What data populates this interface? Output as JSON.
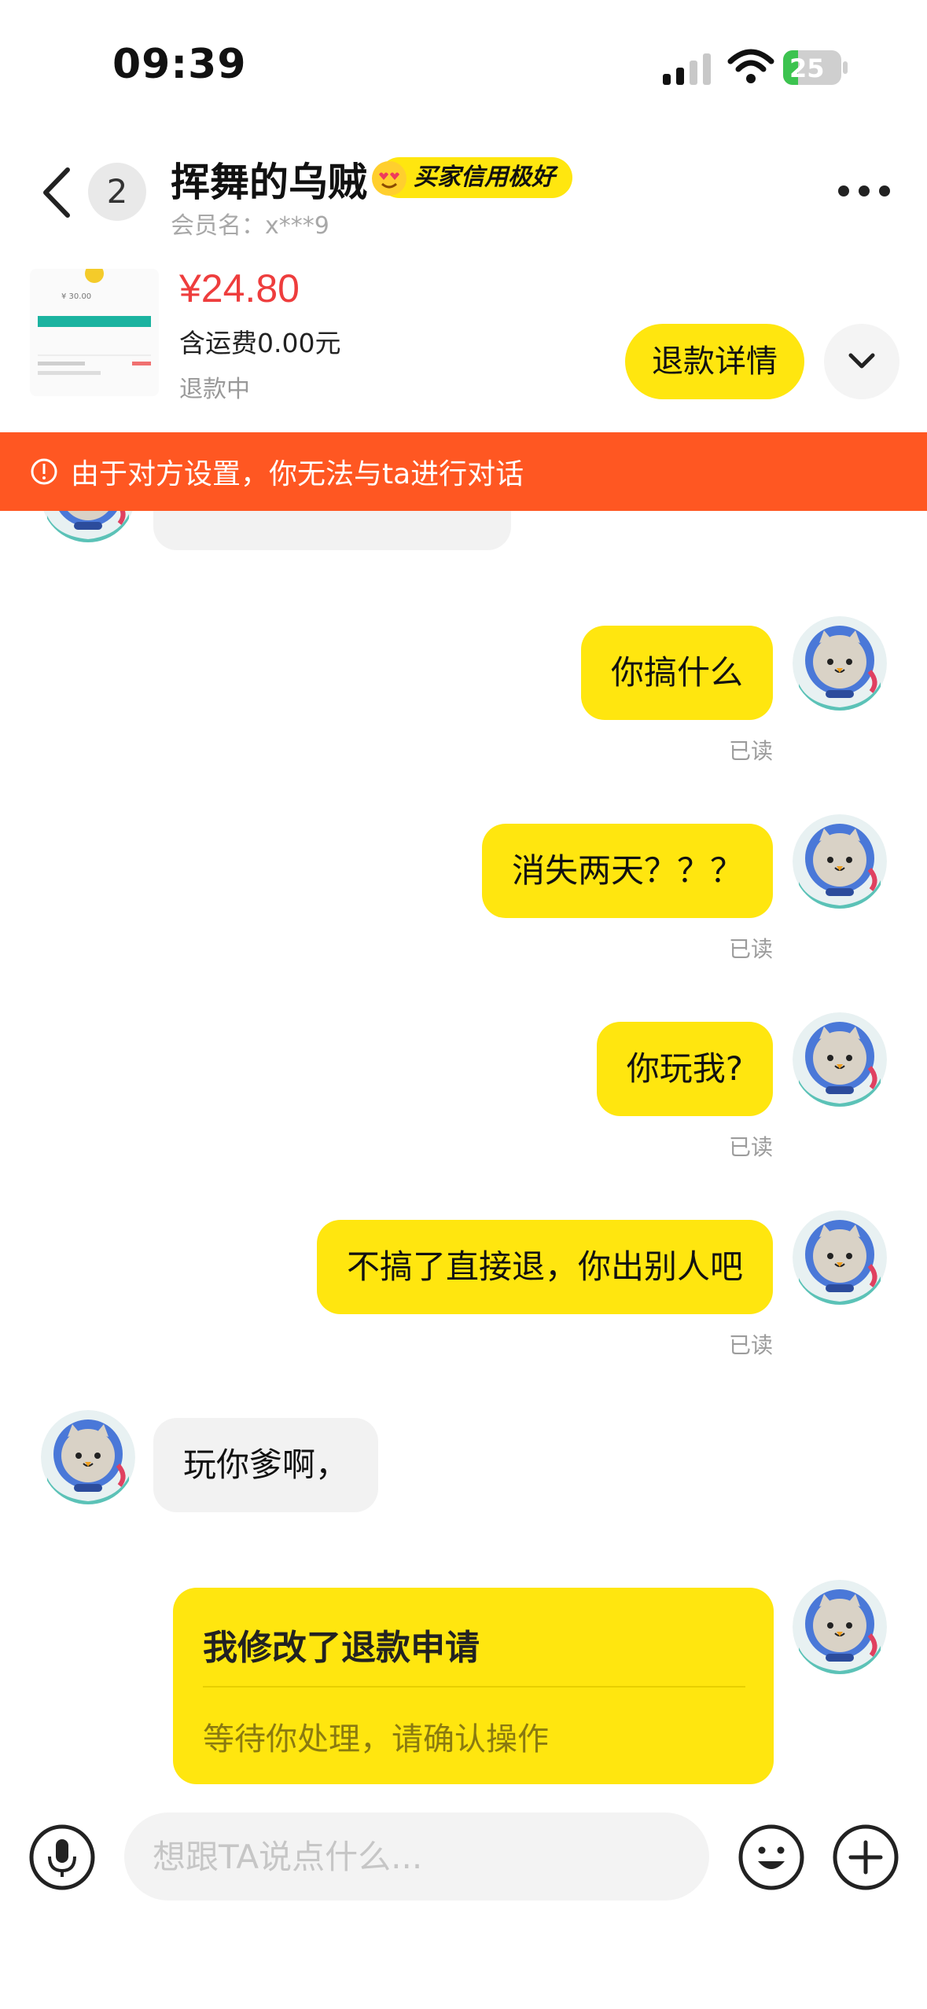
{
  "status_bar": {
    "time": "09:39",
    "battery": "25",
    "battery_level": 0.25,
    "battery_color": "#3cc34f"
  },
  "header": {
    "unread_count": "2",
    "title": "挥舞的乌贼",
    "credit_badge": "买家信用极好",
    "member_name": "会员名：x***9",
    "back_icon": "chevron-left-icon",
    "more_icon": "more-dots-icon"
  },
  "product": {
    "price": "¥24.80",
    "shipping": "含运费0.00元",
    "status": "退款中",
    "refund_detail_button": "退款详情",
    "expand_icon": "chevron-down-icon",
    "thumbnail": {
      "amount": "¥ 30.00"
    }
  },
  "banner": {
    "text": "由于对方设置，你无法与ta进行对话",
    "icon": "alert-circle-icon",
    "color": "#ff5722"
  },
  "messages": [
    {
      "side": "right",
      "text": "你搞什么",
      "status": "已读"
    },
    {
      "side": "right",
      "text": "消失两天？？？",
      "status": "已读"
    },
    {
      "side": "right",
      "text": "你玩我?",
      "status": "已读"
    },
    {
      "side": "right",
      "text": "不搞了直接退，你出别人吧",
      "status": "已读"
    },
    {
      "side": "left",
      "text": "玩你爹啊，"
    }
  ],
  "card_message": {
    "title": "我修改了退款申请",
    "subtitle": "等待你处理，请确认操作"
  },
  "input_bar": {
    "placeholder": "想跟TA说点什么...",
    "voice_icon": "microphone-icon",
    "emoji_icon": "emoji-icon",
    "plus_icon": "plus-circle-icon"
  },
  "colors": {
    "accent": "#ffe60f",
    "price": "#ee3d3d",
    "bubble_left": "#f2f2f2"
  }
}
